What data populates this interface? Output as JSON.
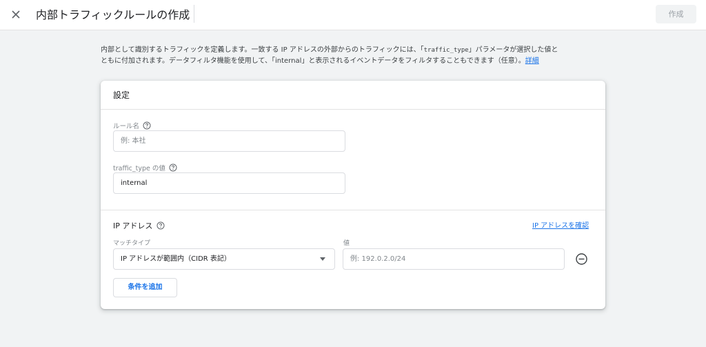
{
  "header": {
    "close_icon": "close-icon",
    "title": "内部トラフィックルールの作成",
    "create_label": "作成"
  },
  "description": {
    "part1": "内部として識別するトラフィックを定義します。一致する IP アドレスの外部からのトラフィックには、「",
    "param_name": "traffic_type",
    "part2": "」パラメータが選択した値と",
    "part3": "ともに付加されます。データフィルタ機能を使用して、「internal」と表示されるイベントデータをフィルタすることもできます（任意）。",
    "link": "詳細"
  },
  "settings": {
    "title": "設定",
    "rule_name": {
      "label": "ルール名",
      "placeholder": "例: 本社",
      "value": ""
    },
    "traffic_type": {
      "label": "traffic_type の値",
      "value": "internal"
    }
  },
  "ip_section": {
    "title": "IP アドレス",
    "check_link": "IP アドレスを確認",
    "match_type_label": "マッチタイプ",
    "match_type_value": "IP アドレスが範囲内（CIDR 表記）",
    "value_label": "値",
    "value_placeholder": "例: 192.0.2.0/24",
    "add_condition_label": "条件を追加"
  },
  "colors": {
    "accent": "#1a73e8",
    "background": "#f1f3f4",
    "card": "#ffffff"
  }
}
